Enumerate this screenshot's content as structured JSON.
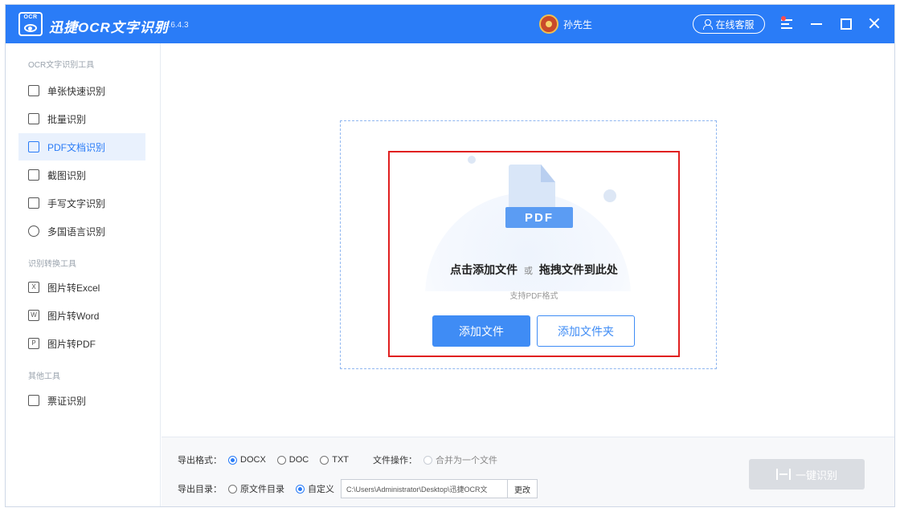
{
  "app": {
    "logo_text": "OCR",
    "title": "迅捷OCR文字识别",
    "version": "v8.6.4.3",
    "user_name": "孙先生",
    "service_label": "在线客服"
  },
  "sidebar": {
    "sections": [
      {
        "title": "OCR文字识别工具",
        "items": [
          {
            "label": "单张快速识别",
            "icon": "single-image-icon"
          },
          {
            "label": "批量识别",
            "icon": "batch-icon"
          },
          {
            "label": "PDF文档识别",
            "icon": "pdf-icon",
            "active": true
          },
          {
            "label": "截图识别",
            "icon": "screenshot-icon"
          },
          {
            "label": "手写文字识别",
            "icon": "handwriting-icon"
          },
          {
            "label": "多国语言识别",
            "icon": "globe-icon"
          }
        ]
      },
      {
        "title": "识别转换工具",
        "items": [
          {
            "label": "图片转Excel",
            "icon": "excel-icon",
            "glyph": "X"
          },
          {
            "label": "图片转Word",
            "icon": "word-icon",
            "glyph": "W"
          },
          {
            "label": "图片转PDF",
            "icon": "pdf-convert-icon",
            "glyph": "P"
          }
        ]
      },
      {
        "title": "其他工具",
        "items": [
          {
            "label": "票证识别",
            "icon": "ticket-icon"
          }
        ]
      }
    ]
  },
  "main": {
    "pdf_badge": "PDF",
    "drop_title_part1": "点击添加文件",
    "drop_title_or": "或",
    "drop_title_part2": "拖拽文件到此处",
    "drop_subtitle": "支持PDF格式",
    "add_file_label": "添加文件",
    "add_folder_label": "添加文件夹"
  },
  "bottom": {
    "format_label": "导出格式：",
    "formats": [
      {
        "label": "DOCX",
        "checked": true
      },
      {
        "label": "DOC",
        "checked": false
      },
      {
        "label": "TXT",
        "checked": false
      }
    ],
    "file_op_label": "文件操作：",
    "merge_label": "合并为一个文件",
    "dir_label": "导出目录：",
    "dir_options": [
      {
        "label": "原文件目录",
        "checked": false
      },
      {
        "label": "自定义",
        "checked": true
      }
    ],
    "path_value": "C:\\Users\\Administrator\\Desktop\\迅捷OCR文",
    "change_label": "更改",
    "recognize_label": "一键识别"
  },
  "colors": {
    "accent": "#2a7cf7",
    "button_blue": "#3f8cf5",
    "highlight_red": "#e02020",
    "disabled_gray": "#dadde2"
  }
}
